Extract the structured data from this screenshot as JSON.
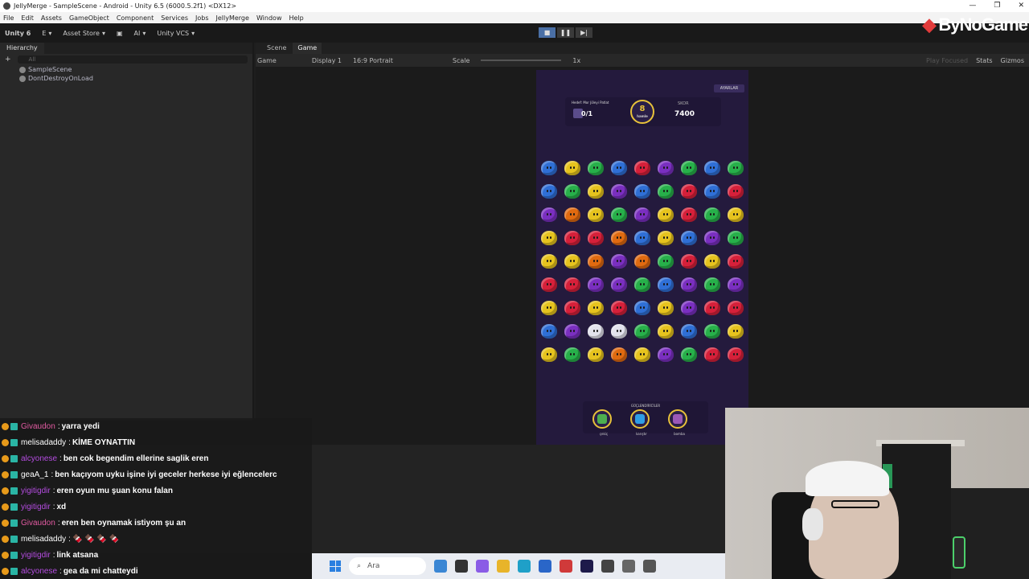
{
  "window": {
    "title": "JellyMerge - SampleScene - Android - Unity 6.5 (6000.5.2f1) <DX12>"
  },
  "menu": [
    "File",
    "Edit",
    "Assets",
    "GameObject",
    "Component",
    "Services",
    "Jobs",
    "JellyMerge",
    "Window",
    "Help"
  ],
  "toolbar": {
    "unity_label": "Unity 6",
    "account_label": "E",
    "asset_store": "Asset Store",
    "ai_label": "AI",
    "vcs": "Unity VCS"
  },
  "watermark": "ByNoGame",
  "hierarchy": {
    "tab": "Hierarchy",
    "search_placeholder": "All",
    "items": [
      "SampleScene",
      "DontDestroyOnLoad"
    ]
  },
  "game": {
    "tabs": [
      "Scene",
      "Game"
    ],
    "bar": {
      "mode": "Game",
      "display": "Display 1",
      "aspect": "16:9 Portrait",
      "scale_label": "Scale",
      "scale_value": "1x",
      "play_focused": "Play Focused",
      "stats": "Stats",
      "gizmos": "Gizmos"
    },
    "top_button": "AYARLAR",
    "hud": {
      "goal_text": "Hedef: Mor Jöleyi Patlat",
      "goal_count": "0/1",
      "moves": "8",
      "moves_label": "hamle",
      "score_label": "SKOR",
      "score": "7400"
    },
    "powerups_title": "GÜÇLENDİRİCİLER",
    "powerups": [
      {
        "label": "çekiç",
        "color": "#4caf50"
      },
      {
        "label": "karıştır",
        "color": "#2f9ee6"
      },
      {
        "label": "bomba",
        "color": "#9b59b6"
      }
    ],
    "board_colors": {
      "b": "#2f6fd6",
      "y": "#e6c31e",
      "g": "#27b04a",
      "r": "#d6203a",
      "p": "#7a2fc0",
      "o": "#e06a10",
      "w": "#e2e2ec"
    },
    "board": [
      "bygbrpgbg",
      "bgypbgrbr",
      "poygpyrgy",
      "yrrobybpg",
      "yyopogryr",
      "rrpp gbpgp",
      "yryrbyprr",
      "bpwwgybgy",
      "ygyoypgrr"
    ]
  },
  "chat": [
    {
      "name": "Givaudon",
      "color": "#e05aa0",
      "msg": "yarra yedi"
    },
    {
      "name": "melisadaddy",
      "color": "#ffffff",
      "msg": "KİME OYNATTIN"
    },
    {
      "name": "alcyonese",
      "color": "#b44ce0",
      "msg": "ben cok begendim ellerine saglik eren"
    },
    {
      "name": "geaA_1",
      "color": "#ffffff",
      "msg": "ben kaçıyom uyku işine iyi geceler herkese iyi eğlencelerc"
    },
    {
      "name": "yigitigdir",
      "color": "#b44ce0",
      "msg": "eren oyun mu şuan konu falan"
    },
    {
      "name": "yigitigdir",
      "color": "#b44ce0",
      "msg": "xd"
    },
    {
      "name": "Givaudon",
      "color": "#e05aa0",
      "msg": "eren ben oynamak istiyom şu an"
    },
    {
      "name": "melisadaddy",
      "color": "#ffffff",
      "msg": "🍫 🍫 🍫 🍫"
    },
    {
      "name": "yigitigdir",
      "color": "#b44ce0",
      "msg": "link atsana"
    },
    {
      "name": "alcyonese",
      "color": "#b44ce0",
      "msg": "gea da mi chatteydi"
    }
  ],
  "taskbar": {
    "search": "Ara"
  }
}
